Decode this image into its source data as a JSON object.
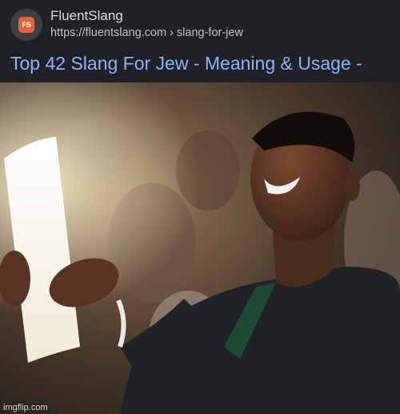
{
  "result": {
    "site_name": "FluentSlang",
    "favicon_text": "FS",
    "url_base": "https://fluentslang.com",
    "url_separator": "›",
    "url_path": "slang-for-jew",
    "title": "Top 42 Slang For Jew - Meaning & Usage -",
    "colors": {
      "title": "#8ab4f8",
      "favicon": "#e8623b",
      "background": "#202124"
    }
  },
  "photo": {
    "icon": "smiling-man-reading-paper-photo",
    "watermark": "imgflip.com"
  }
}
